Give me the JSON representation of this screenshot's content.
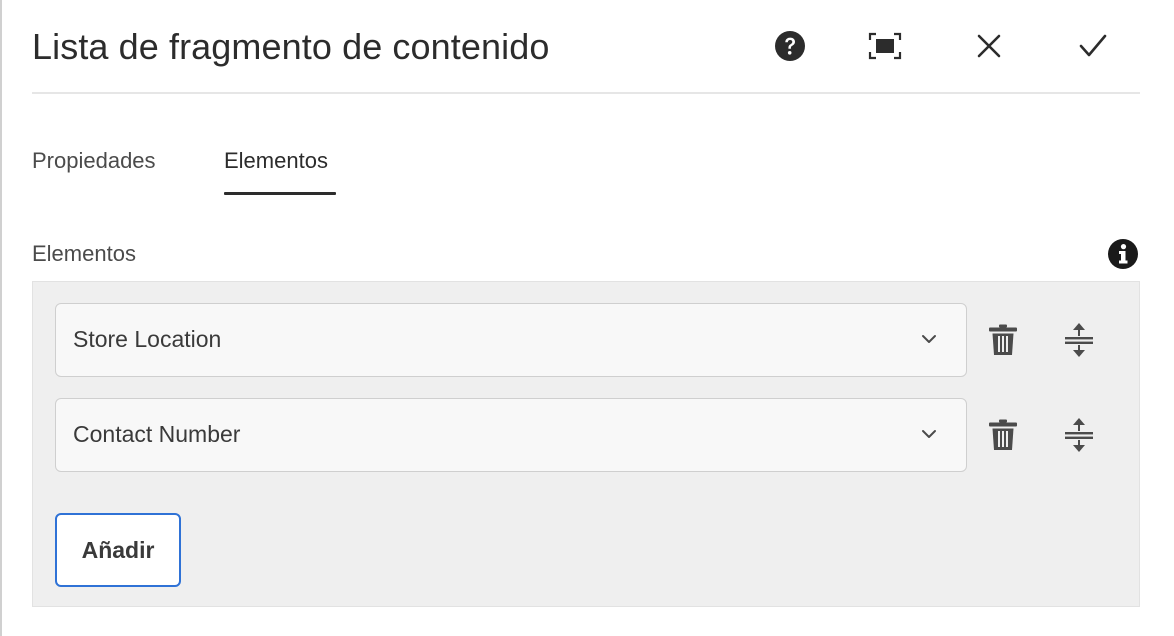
{
  "dialog": {
    "title": "Lista de fragmento de contenido",
    "header_icons": [
      "help-icon",
      "fullscreen-icon",
      "close-icon",
      "checkmark-icon"
    ]
  },
  "tabs": [
    {
      "label": "Propiedades",
      "active": false
    },
    {
      "label": "Elementos",
      "active": true
    }
  ],
  "elements_field": {
    "label": "Elementos",
    "info_icon": "info-icon",
    "items": [
      {
        "value": "Store Location",
        "icons": [
          "chevron-down-icon",
          "trash-icon",
          "reorder-icon"
        ]
      },
      {
        "value": "Contact Number",
        "icons": [
          "chevron-down-icon",
          "trash-icon",
          "reorder-icon"
        ]
      }
    ],
    "add_label": "Añadir"
  },
  "colors": {
    "accent_border": "#2f72d6",
    "text": "#2c2c2c",
    "panel_bg": "#efefef"
  }
}
